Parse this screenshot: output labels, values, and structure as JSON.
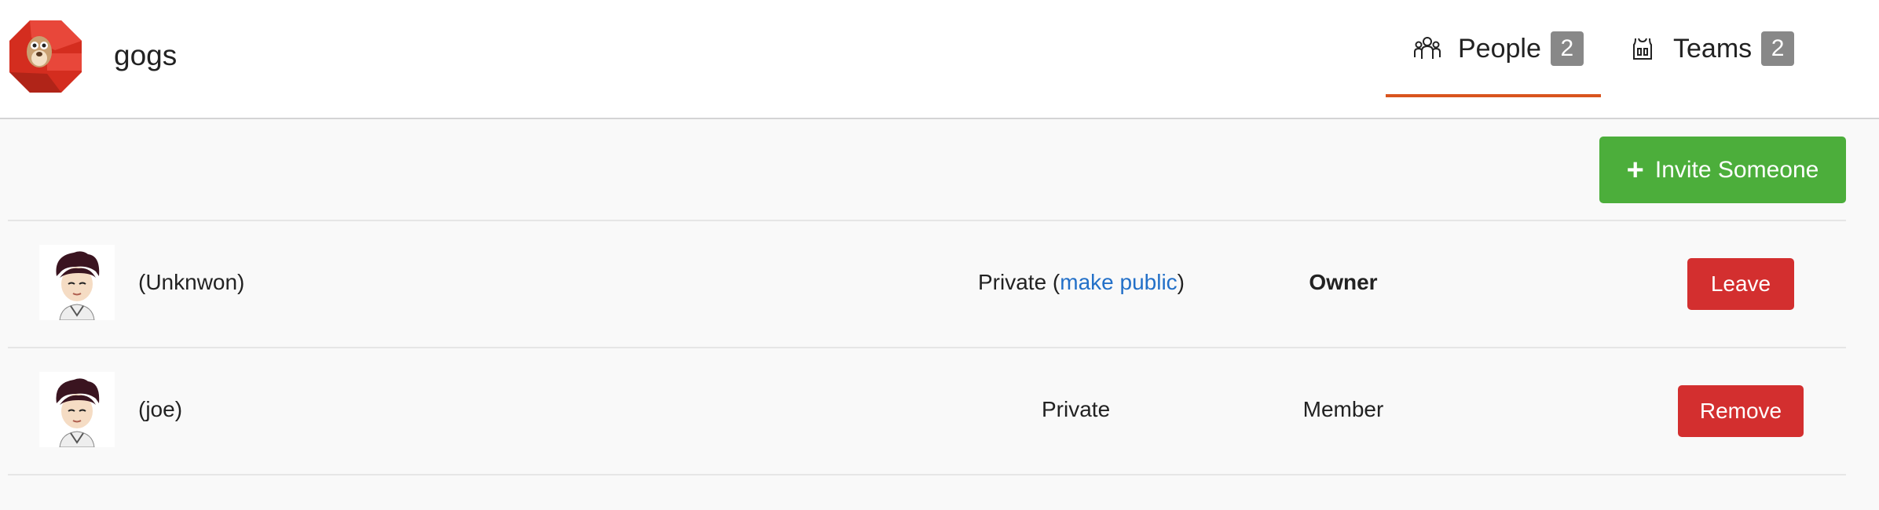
{
  "header": {
    "org_name": "gogs",
    "logo_icon": "gogs-logo",
    "tabs": [
      {
        "label": "People",
        "count": "2",
        "icon": "people-icon",
        "active": true
      },
      {
        "label": "Teams",
        "count": "2",
        "icon": "teams-icon",
        "active": false
      }
    ]
  },
  "actions": {
    "invite_label": "Invite Someone",
    "invite_icon": "plus-icon"
  },
  "members": [
    {
      "name": "(Unknwon)",
      "visibility": "Private",
      "visibility_link": "make public",
      "role": "Owner",
      "action": "Leave"
    },
    {
      "name": "(joe)",
      "visibility": "Private",
      "role": "Member",
      "action": "Remove"
    }
  ],
  "colors": {
    "accent": "#d9541e",
    "invite_button": "#4cae3b",
    "danger_button": "#d32f2f",
    "link": "#2370c8",
    "badge": "#888888"
  }
}
